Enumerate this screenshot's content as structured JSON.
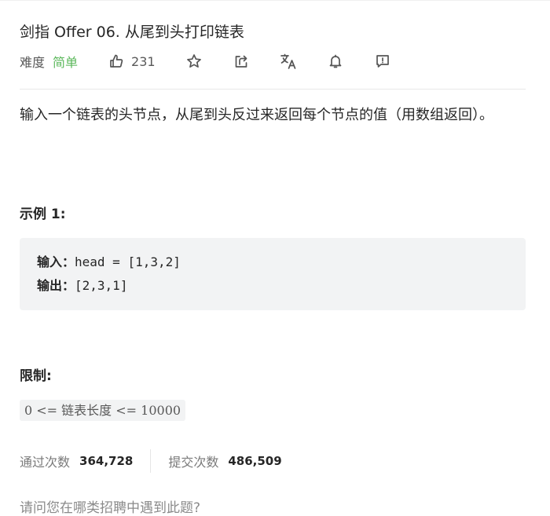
{
  "problem": {
    "title": "剑指 Offer 06. 从尾到头打印链表",
    "difficulty_label": "难度",
    "difficulty_value": "简单",
    "like_count": "231",
    "icons": [
      "thumbs-up-icon",
      "star-icon",
      "share-icon",
      "translate-icon",
      "bell-icon",
      "feedback-icon"
    ],
    "colors": {
      "easy": "#5cb85c",
      "code_bg": "#f2f3f4"
    }
  },
  "description": {
    "text": "输入一个链表的头节点，从尾到头反过来返回每个节点的值（用数组返回）。"
  },
  "example": {
    "heading": "示例 1:",
    "input_label": "输入：",
    "input_value": "head = [1,3,2]",
    "output_label": "输出：",
    "output_value": "[2,3,1]"
  },
  "constraints": {
    "heading": "限制:",
    "text": "0 <= 链表长度 <= 10000"
  },
  "stats": {
    "accepted_label": "通过次数",
    "accepted_value": "364,728",
    "submitted_label": "提交次数",
    "submitted_value": "486,509"
  },
  "interview": {
    "text": "请问您在哪类招聘中遇到此题?"
  }
}
